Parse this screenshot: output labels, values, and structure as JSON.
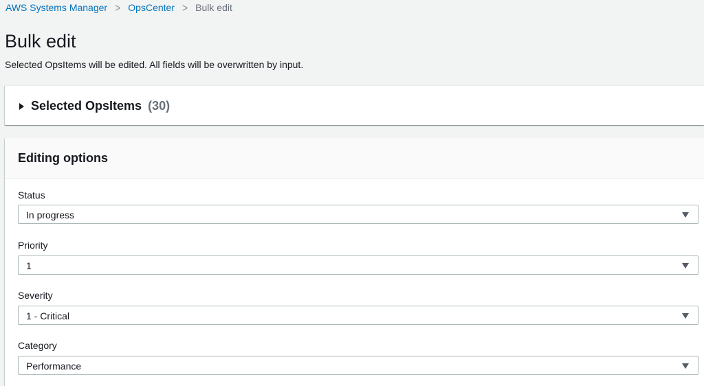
{
  "breadcrumb": {
    "items": [
      "AWS Systems Manager",
      "OpsCenter"
    ],
    "current": "Bulk edit"
  },
  "page": {
    "title": "Bulk edit",
    "description": "Selected OpsItems will be edited. All fields will be overwritten by input."
  },
  "selected_panel": {
    "title": "Selected OpsItems",
    "count": "(30)",
    "expand_icon": "caret-right-icon"
  },
  "editing_panel": {
    "title": "Editing options",
    "fields": [
      {
        "label": "Status",
        "value": "In progress"
      },
      {
        "label": "Priority",
        "value": "1"
      },
      {
        "label": "Severity",
        "value": "1 - Critical"
      },
      {
        "label": "Category",
        "value": "Performance"
      }
    ],
    "dropdown_icon": "caret-down-icon"
  },
  "colors": {
    "link": "#0073bb",
    "background": "#f2f3f3",
    "text": "#16191f",
    "muted": "#687078"
  }
}
